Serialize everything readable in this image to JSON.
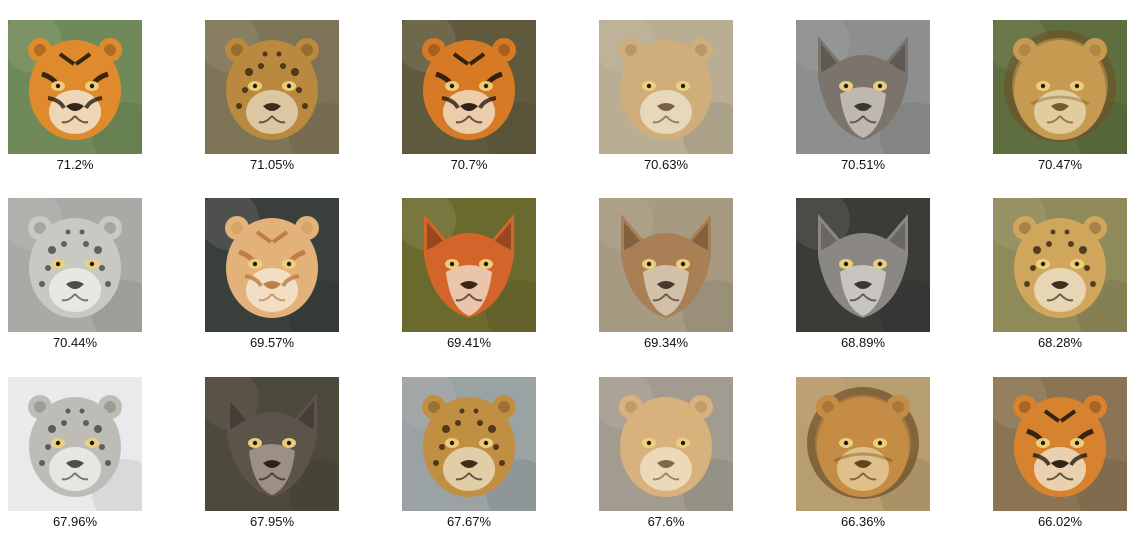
{
  "grid": {
    "items": [
      {
        "score": "71.2%",
        "animal": "tiger",
        "bg": "#6f8a58",
        "fur": "#e08a2e",
        "mark": "#1a1208",
        "light": "#f4efe4"
      },
      {
        "score": "71.05%",
        "animal": "leopard",
        "bg": "#7d7458",
        "fur": "#b8893e",
        "mark": "#2a1c0c",
        "light": "#e8dcc4"
      },
      {
        "score": "70.7%",
        "animal": "tiger",
        "bg": "#5f5a3e",
        "fur": "#d77a26",
        "mark": "#181008",
        "light": "#f2ead8"
      },
      {
        "score": "70.63%",
        "animal": "lioness",
        "bg": "#b9ad93",
        "fur": "#cfae7c",
        "mark": "#6b5438",
        "light": "#efe4d0"
      },
      {
        "score": "70.51%",
        "animal": "wolf",
        "bg": "#8d8f8f",
        "fur": "#7b746c",
        "mark": "#2b2825",
        "light": "#dcd6cc"
      },
      {
        "score": "70.47%",
        "animal": "lion",
        "bg": "#5e6e3e",
        "fur": "#c79a52",
        "mark": "#6e4e22",
        "light": "#eadcb8"
      },
      {
        "score": "70.44%",
        "animal": "snow-leopard",
        "bg": "#a8aaa6",
        "fur": "#c9c9c4",
        "mark": "#3c3c3a",
        "light": "#f2f2ee"
      },
      {
        "score": "69.57%",
        "animal": "golden-tiger",
        "bg": "#3a3f3c",
        "fur": "#e3b27a",
        "mark": "#b87638",
        "light": "#f6ecde"
      },
      {
        "score": "69.41%",
        "animal": "fox",
        "bg": "#6a6a2e",
        "fur": "#d3652a",
        "mark": "#2a140a",
        "light": "#f4ece2"
      },
      {
        "score": "69.34%",
        "animal": "fox",
        "bg": "#a69a82",
        "fur": "#a97f55",
        "mark": "#3a2a1c",
        "light": "#e6dccd"
      },
      {
        "score": "68.89%",
        "animal": "wolf",
        "bg": "#3a3c38",
        "fur": "#8a8784",
        "mark": "#2a2826",
        "light": "#e3e0da"
      },
      {
        "score": "68.28%",
        "animal": "jaguar",
        "bg": "#8f8a5a",
        "fur": "#cfa65c",
        "mark": "#2a1c0c",
        "light": "#efe6d2"
      },
      {
        "score": "67.96%",
        "animal": "snow-leopard",
        "bg": "#e8eaec",
        "fur": "#bdbcb6",
        "mark": "#3e3d3a",
        "light": "#f5f4f0"
      },
      {
        "score": "67.95%",
        "animal": "wolf",
        "bg": "#4d4a3c",
        "fur": "#5c534a",
        "mark": "#1c1a18",
        "light": "#b9aa98"
      },
      {
        "score": "67.67%",
        "animal": "leopard",
        "bg": "#9aa2a4",
        "fur": "#c08f42",
        "mark": "#2a1c0c",
        "light": "#ede2cc"
      },
      {
        "score": "67.6%",
        "animal": "lioness",
        "bg": "#a29c90",
        "fur": "#d7b27c",
        "mark": "#7a5a34",
        "light": "#f1e5cf"
      },
      {
        "score": "66.36%",
        "animal": "lion",
        "bg": "#b79e6e",
        "fur": "#c48c44",
        "mark": "#5a3614",
        "light": "#e9d2a2"
      },
      {
        "score": "66.02%",
        "animal": "tiger-cub",
        "bg": "#8a7454",
        "fur": "#d6822f",
        "mark": "#1a1208",
        "light": "#f2e9d8"
      }
    ]
  }
}
